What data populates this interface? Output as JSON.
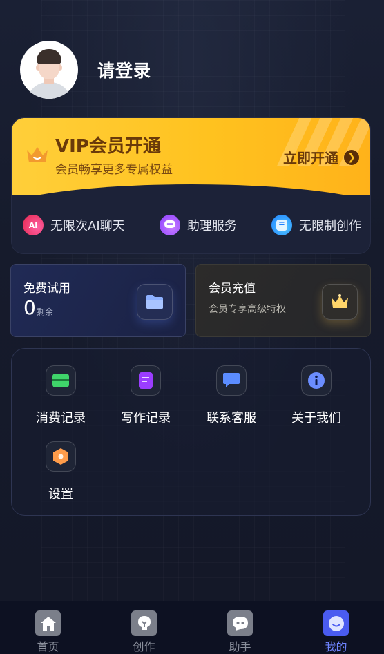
{
  "profile": {
    "avatar_icon": "user-avatar-icon",
    "username": "请登录"
  },
  "vip": {
    "title": "VIP会员开通",
    "subtitle": "会员畅享更多专属权益",
    "cta_label": "立即开通",
    "accent": "#ffc21f",
    "benefits": [
      {
        "label": "无限次AI聊天",
        "icon": "ai-chat-icon",
        "badge": "AI"
      },
      {
        "label": "助理服务",
        "icon": "assistant-icon"
      },
      {
        "label": "无限制创作",
        "icon": "create-icon"
      }
    ]
  },
  "cards": {
    "free_trial": {
      "title": "免费试用",
      "count": "0",
      "unit": "剩余",
      "icon": "folder-icon"
    },
    "recharge": {
      "title": "会员充值",
      "subtitle": "会员专享高级特权",
      "icon": "crown-icon"
    }
  },
  "menu": {
    "items": [
      {
        "label": "消费记录",
        "icon": "wallet-icon"
      },
      {
        "label": "写作记录",
        "icon": "document-icon"
      },
      {
        "label": "联系客服",
        "icon": "chat-bubble-icon"
      },
      {
        "label": "关于我们",
        "icon": "info-icon"
      },
      {
        "label": "设置",
        "icon": "settings-hexagon-icon"
      }
    ]
  },
  "tabbar": {
    "tabs": [
      {
        "label": "首页",
        "icon": "home-icon",
        "active": false
      },
      {
        "label": "创作",
        "icon": "bulb-icon",
        "active": false
      },
      {
        "label": "助手",
        "icon": "assistant-bot-icon",
        "active": false
      },
      {
        "label": "我的",
        "icon": "profile-icon",
        "active": true
      }
    ],
    "active_color": "#6e84ff"
  }
}
